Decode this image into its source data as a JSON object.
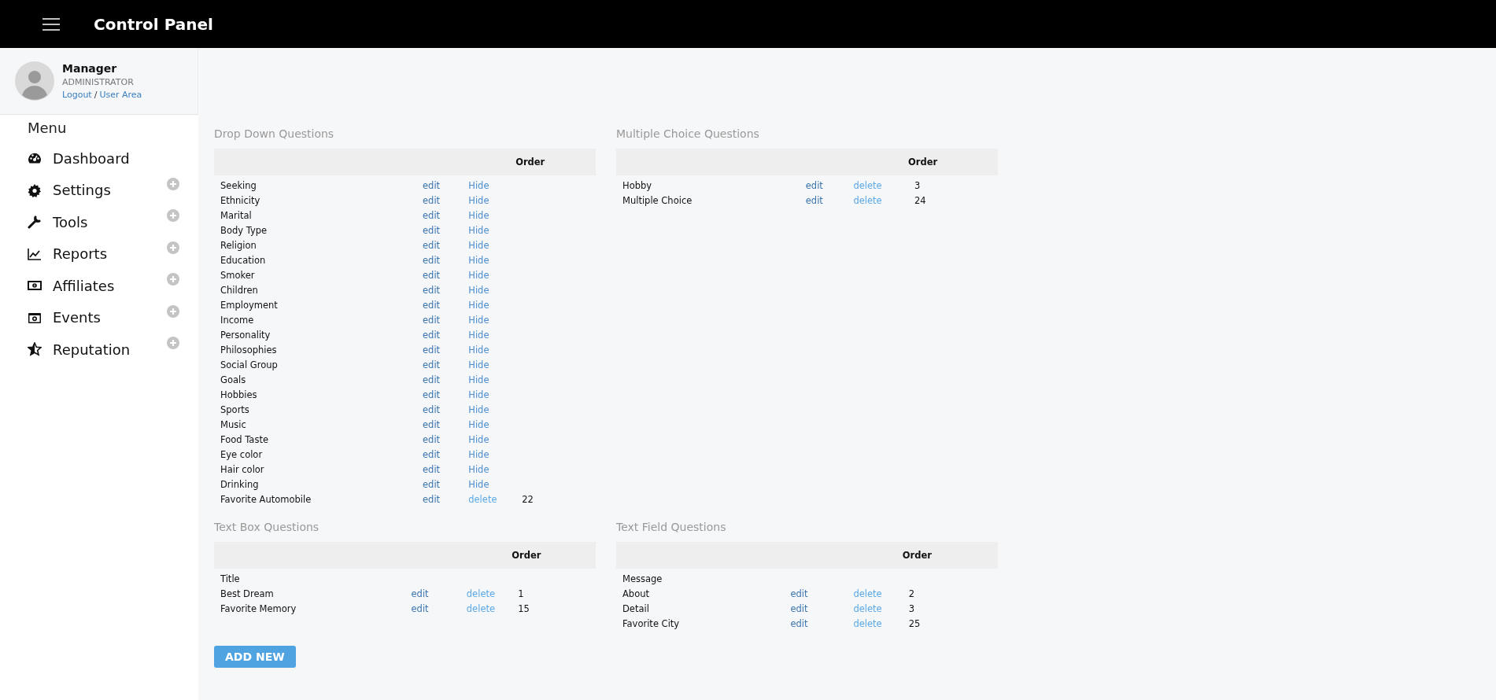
{
  "header": {
    "title": "Control Panel"
  },
  "profile": {
    "name": "Manager",
    "role": "ADMINISTRATOR",
    "links": [
      {
        "label": "Logout"
      },
      {
        "label": "User Area"
      }
    ],
    "separator": "/"
  },
  "menu": {
    "title": "Menu",
    "items": [
      {
        "label": "Dashboard",
        "kind": "dashboard",
        "expandable": false
      },
      {
        "label": "Settings",
        "kind": "settings",
        "expandable": true
      },
      {
        "label": "Tools",
        "kind": "tools",
        "expandable": true
      },
      {
        "label": "Reports",
        "kind": "reports",
        "expandable": true
      },
      {
        "label": "Affiliates",
        "kind": "affiliates",
        "expandable": true
      },
      {
        "label": "Events",
        "kind": "events",
        "expandable": true
      },
      {
        "label": "Reputation",
        "kind": "reputation",
        "expandable": true
      }
    ]
  },
  "sections": [
    {
      "kind": "dropdown",
      "title": "Drop Down Questions",
      "columns": [
        "",
        "",
        "",
        "Order"
      ],
      "rows": [
        {
          "name": "Seeking",
          "edit": "edit",
          "action": {
            "label": "Hide",
            "kind": "hide"
          }
        },
        {
          "name": "Ethnicity",
          "edit": "edit",
          "action": {
            "label": "Hide",
            "kind": "hide"
          }
        },
        {
          "name": "Marital",
          "edit": "edit",
          "action": {
            "label": "Hide",
            "kind": "hide"
          }
        },
        {
          "name": "Body Type",
          "edit": "edit",
          "action": {
            "label": "Hide",
            "kind": "hide"
          }
        },
        {
          "name": "Religion",
          "edit": "edit",
          "action": {
            "label": "Hide",
            "kind": "hide"
          }
        },
        {
          "name": "Education",
          "edit": "edit",
          "action": {
            "label": "Hide",
            "kind": "hide"
          }
        },
        {
          "name": "Smoker",
          "edit": "edit",
          "action": {
            "label": "Hide",
            "kind": "hide"
          }
        },
        {
          "name": "Children",
          "edit": "edit",
          "action": {
            "label": "Hide",
            "kind": "hide"
          }
        },
        {
          "name": "Employment",
          "edit": "edit",
          "action": {
            "label": "Hide",
            "kind": "hide"
          }
        },
        {
          "name": "Income",
          "edit": "edit",
          "action": {
            "label": "Hide",
            "kind": "hide"
          }
        },
        {
          "name": "Personality",
          "edit": "edit",
          "action": {
            "label": "Hide",
            "kind": "hide"
          }
        },
        {
          "name": "Philosophies",
          "edit": "edit",
          "action": {
            "label": "Hide",
            "kind": "hide"
          }
        },
        {
          "name": "Social Group",
          "edit": "edit",
          "action": {
            "label": "Hide",
            "kind": "hide"
          }
        },
        {
          "name": "Goals",
          "edit": "edit",
          "action": {
            "label": "Hide",
            "kind": "hide"
          }
        },
        {
          "name": "Hobbies",
          "edit": "edit",
          "action": {
            "label": "Hide",
            "kind": "hide"
          }
        },
        {
          "name": "Sports",
          "edit": "edit",
          "action": {
            "label": "Hide",
            "kind": "hide"
          }
        },
        {
          "name": "Music",
          "edit": "edit",
          "action": {
            "label": "Hide",
            "kind": "hide"
          }
        },
        {
          "name": "Food Taste",
          "edit": "edit",
          "action": {
            "label": "Hide",
            "kind": "hide"
          }
        },
        {
          "name": "Eye color",
          "edit": "edit",
          "action": {
            "label": "Hide",
            "kind": "hide"
          }
        },
        {
          "name": "Hair color",
          "edit": "edit",
          "action": {
            "label": "Hide",
            "kind": "hide"
          }
        },
        {
          "name": "Drinking",
          "edit": "edit",
          "action": {
            "label": "Hide",
            "kind": "hide"
          }
        },
        {
          "name": "Favorite Automobile",
          "edit": "edit",
          "action": {
            "label": "delete",
            "kind": "delete"
          },
          "order": "22"
        }
      ]
    },
    {
      "kind": "multiple",
      "title": "Multiple Choice Questions",
      "columns": [
        "",
        "",
        "",
        "Order"
      ],
      "rows": [
        {
          "name": "Hobby",
          "edit": "edit",
          "action": {
            "label": "delete",
            "kind": "delete"
          },
          "order": "3"
        },
        {
          "name": "Multiple Choice",
          "edit": "edit",
          "action": {
            "label": "delete",
            "kind": "delete"
          },
          "order": "24"
        }
      ]
    },
    {
      "kind": "textbox",
      "title": "Text Box Questions",
      "columns": [
        "",
        "",
        "",
        "Order"
      ],
      "rows": [
        {
          "name": "Title"
        },
        {
          "name": "Best Dream",
          "edit": "edit",
          "action": {
            "label": "delete",
            "kind": "delete"
          },
          "order": "1"
        },
        {
          "name": "Favorite Memory",
          "edit": "edit",
          "action": {
            "label": "delete",
            "kind": "delete"
          },
          "order": "15"
        }
      ]
    },
    {
      "kind": "textfield",
      "title": "Text Field Questions",
      "columns": [
        "",
        "",
        "",
        "Order"
      ],
      "rows": [
        {
          "name": "Message"
        },
        {
          "name": "About",
          "edit": "edit",
          "action": {
            "label": "delete",
            "kind": "delete"
          },
          "order": "2"
        },
        {
          "name": "Detail",
          "edit": "edit",
          "action": {
            "label": "delete",
            "kind": "delete"
          },
          "order": "3"
        },
        {
          "name": "Favorite City",
          "edit": "edit",
          "action": {
            "label": "delete",
            "kind": "delete"
          },
          "order": "25"
        }
      ]
    }
  ],
  "add_button": {
    "label": "ADD NEW"
  }
}
